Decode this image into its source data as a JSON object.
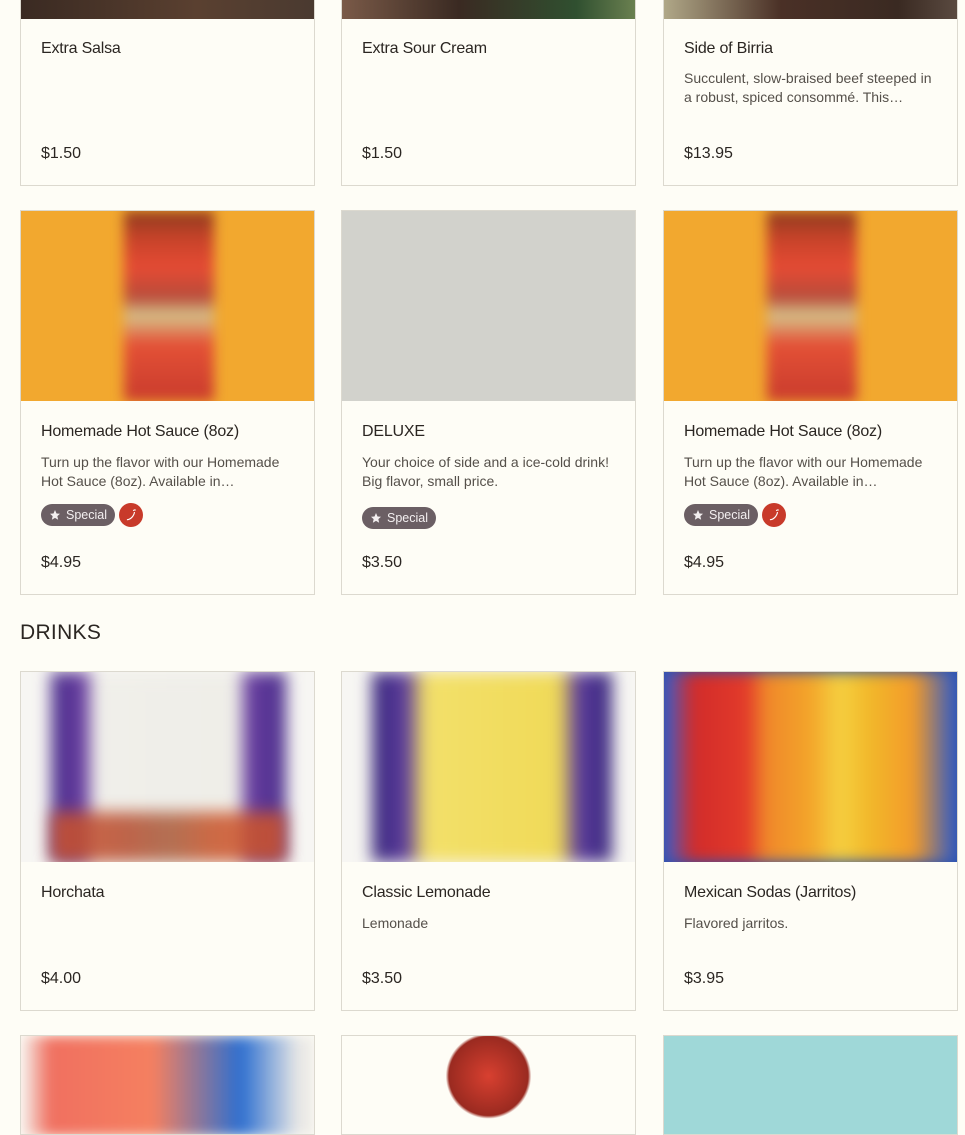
{
  "top_row": [
    {
      "title": "Extra Salsa",
      "description": "",
      "price": "$1.50"
    },
    {
      "title": "Extra Sour Cream",
      "description": "",
      "price": "$1.50"
    },
    {
      "title": "Side of Birria",
      "description": "Succulent, slow-braised beef steeped in a robust, spiced consommé. This…",
      "price": "$13.95"
    }
  ],
  "middle_row": [
    {
      "title": "Homemade Hot Sauce (8oz)",
      "description": "Turn up the flavor with our Homemade Hot Sauce (8oz). Available in…",
      "badge": "Special",
      "spicy": true,
      "price": "$4.95"
    },
    {
      "title": "DELUXE",
      "description": "Your choice of side and a ice-cold drink! Big flavor, small price.",
      "badge": "Special",
      "spicy": false,
      "price": "$3.50"
    },
    {
      "title": "Homemade Hot Sauce (8oz)",
      "description": "Turn up the flavor with our Homemade Hot Sauce (8oz). Available in…",
      "badge": "Special",
      "spicy": true,
      "price": "$4.95"
    }
  ],
  "drinks_section": {
    "title": "DRINKS",
    "items": [
      {
        "title": "Horchata",
        "description": "",
        "price": "$4.00"
      },
      {
        "title": "Classic Lemonade",
        "description": "Lemonade",
        "price": "$3.50"
      },
      {
        "title": "Mexican Sodas (Jarritos)",
        "description": "Flavored jarritos.",
        "price": "$3.95"
      }
    ]
  },
  "icons": {
    "badge_icon": "star-icon",
    "spicy_icon": "chili-pepper-icon"
  },
  "colors": {
    "badge_bg": "#6b5f64",
    "spicy_bg": "#c83a2a",
    "page_bg": "#fefdf6"
  }
}
